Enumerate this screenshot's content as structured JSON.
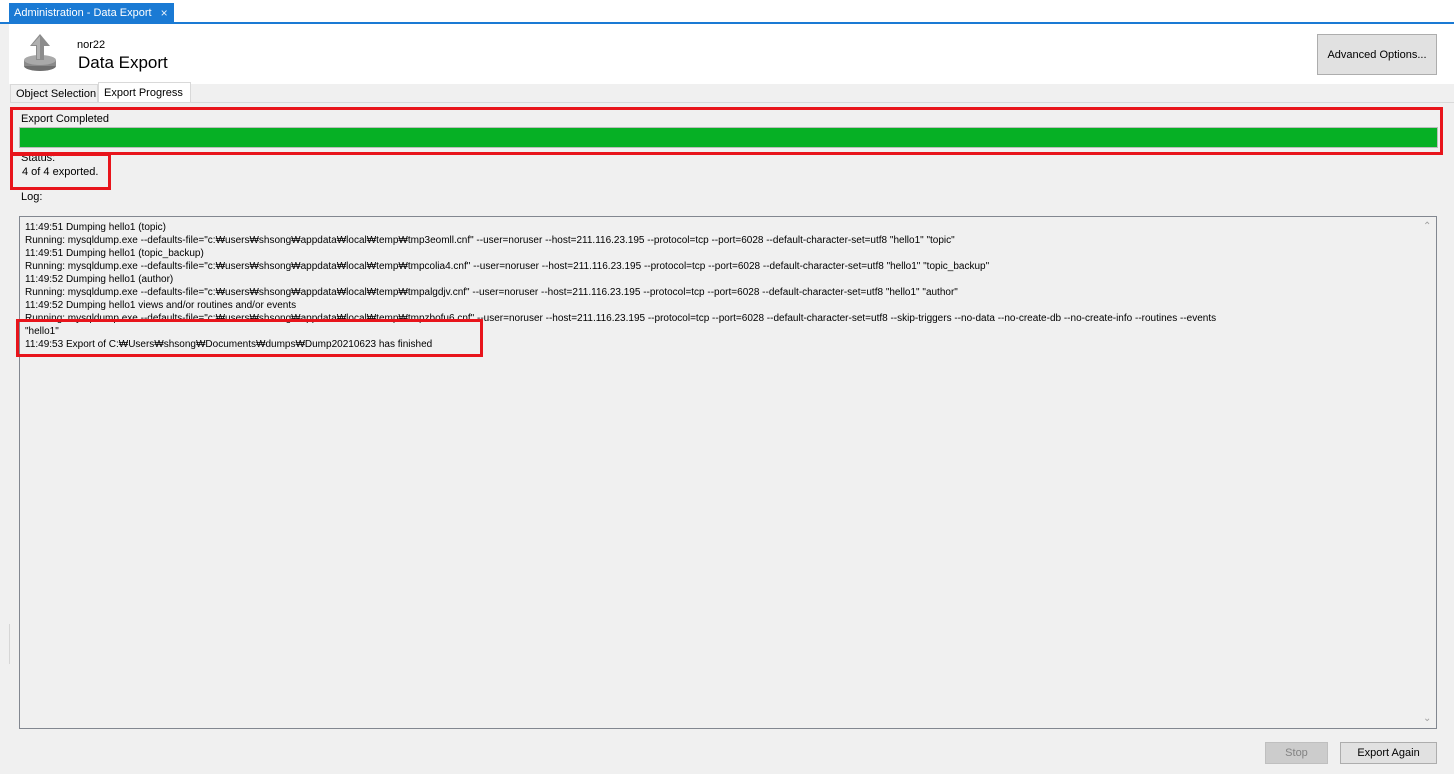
{
  "document_tab": {
    "label": "Administration - Data Export",
    "close_glyph": "×"
  },
  "header": {
    "connection_name": "nor22",
    "title": "Data Export",
    "icon": "export-upload-icon",
    "advanced_options_label": "Advanced Options..."
  },
  "tabs": [
    {
      "label": "Object Selection",
      "active": false
    },
    {
      "label": "Export Progress",
      "active": true
    }
  ],
  "progress": {
    "label": "Export Completed",
    "fraction": 1.0,
    "fill_color": "#06b025"
  },
  "status": {
    "label": "Status:",
    "text": "4 of 4 exported."
  },
  "log": {
    "label": "Log:",
    "lines": [
      "11:49:51 Dumping hello1 (topic)",
      "Running: mysqldump.exe --defaults-file=\"c:₩users₩shsong₩appdata₩local₩temp₩tmp3eomll.cnf\"  --user=noruser --host=211.116.23.195 --protocol=tcp --port=6028 --default-character-set=utf8 \"hello1\" \"topic\"",
      "11:49:51 Dumping hello1 (topic_backup)",
      "Running: mysqldump.exe --defaults-file=\"c:₩users₩shsong₩appdata₩local₩temp₩tmpcolia4.cnf\"  --user=noruser --host=211.116.23.195 --protocol=tcp --port=6028 --default-character-set=utf8 \"hello1\" \"topic_backup\"",
      "11:49:52 Dumping hello1 (author)",
      "Running: mysqldump.exe --defaults-file=\"c:₩users₩shsong₩appdata₩local₩temp₩tmpalgdjv.cnf\"  --user=noruser --host=211.116.23.195 --protocol=tcp --port=6028 --default-character-set=utf8 \"hello1\" \"author\"",
      "11:49:52 Dumping hello1 views and/or routines and/or events",
      "Running: mysqldump.exe --defaults-file=\"c:₩users₩shsong₩appdata₩local₩temp₩tmpzbofu6.cnf\"  --user=noruser --host=211.116.23.195 --protocol=tcp --port=6028 --default-character-set=utf8 --skip-triggers  --no-data  --no-create-db --no-create-info --routines --events",
      "\"hello1\"",
      "11:49:53 Export of C:₩Users₩shsong₩Documents₩dumps₩Dump20210623 has finished"
    ]
  },
  "buttons": {
    "stop": "Stop",
    "export_again": "Export Again"
  },
  "highlight_color": "#e8141b"
}
